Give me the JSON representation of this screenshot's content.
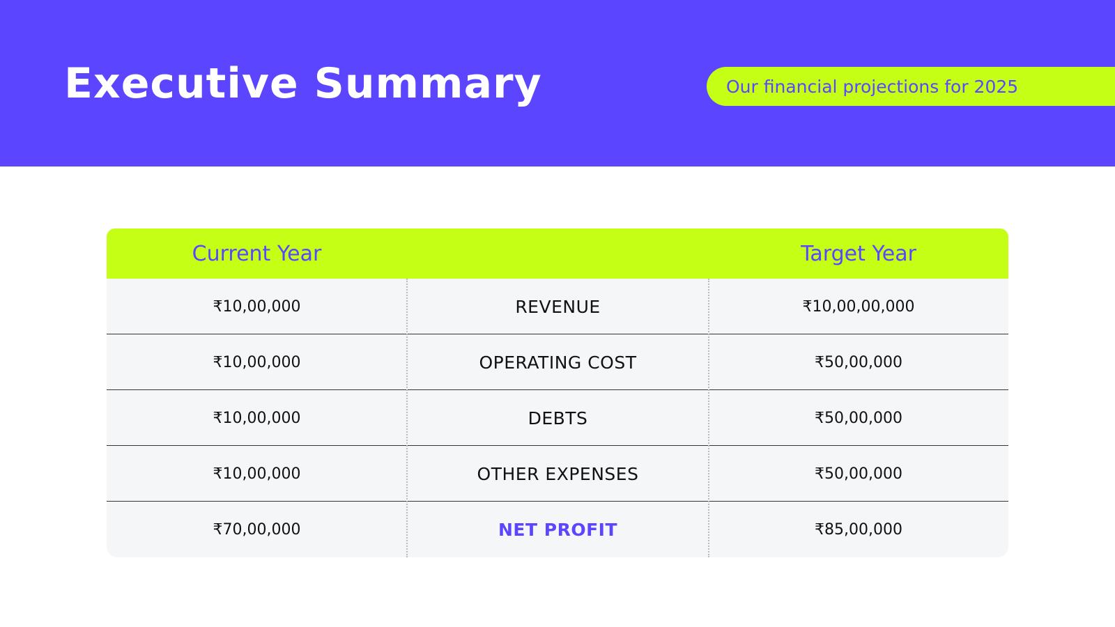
{
  "header": {
    "title": "Executive Summary",
    "subtitle": "Our financial projections for 2025"
  },
  "colors": {
    "primary": "#5b45ff",
    "accent": "#c6ff16",
    "table_bg": "#f5f6f8"
  },
  "table": {
    "columns": {
      "current": "Current Year",
      "metric": "",
      "target": "Target Year"
    },
    "rows": [
      {
        "current": "₹10,00,000",
        "metric": "REVENUE",
        "target": "₹10,00,00,000"
      },
      {
        "current": "₹10,00,000",
        "metric": "OPERATING COST",
        "target": "₹50,00,000"
      },
      {
        "current": "₹10,00,000",
        "metric": "DEBTS",
        "target": "₹50,00,000"
      },
      {
        "current": "₹10,00,000",
        "metric": "OTHER EXPENSES",
        "target": "₹50,00,000"
      },
      {
        "current": "₹70,00,000",
        "metric": "NET PROFIT",
        "target": "₹85,00,000"
      }
    ]
  }
}
